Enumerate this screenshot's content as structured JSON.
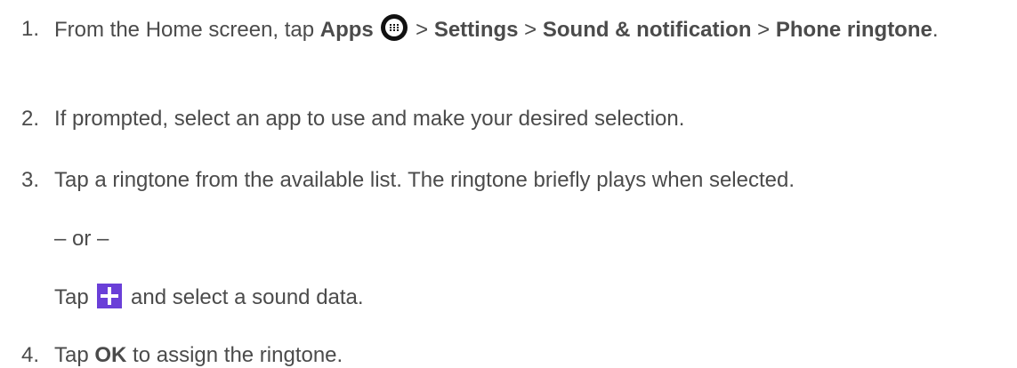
{
  "steps": [
    {
      "number": "1.",
      "prefix": "From the Home screen, tap ",
      "apps": "Apps",
      "sep1": " > ",
      "settings": "Settings",
      "sep2": " > ",
      "sound": "Sound & notification",
      "sep3": " > ",
      "phone_ringtone": "Phone ringtone",
      "suffix": "."
    },
    {
      "number": "2.",
      "text": "If prompted, select an app to use and make your desired selection."
    },
    {
      "number": "3.",
      "text": "Tap a ringtone from the available list. The ringtone briefly plays when selected.",
      "or": "– or –",
      "alt_prefix": "Tap ",
      "alt_suffix": " and select a sound data."
    },
    {
      "number": "4.",
      "prefix": "Tap ",
      "ok": "OK",
      "suffix": " to assign the ringtone."
    }
  ],
  "icons": {
    "apps": "apps-grid-icon",
    "add": "plus-icon"
  },
  "colors": {
    "text": "#4b4b4b",
    "add_icon_bg": "#6a3fd8",
    "apps_icon_bg": "#111111"
  }
}
